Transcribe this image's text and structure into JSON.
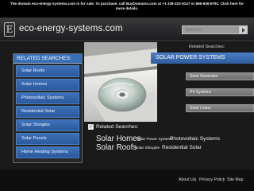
{
  "notice": "The domain eco-energy-systems.com is for sale. To purchase, call BuyDomains.com at +1 339-222-5147 or 866-836-6791. Click here for more details.",
  "header": {
    "logo_letter": "E",
    "site_title": "eco-energy-systems.com",
    "search_placeholder": "SEARCH"
  },
  "left_panel": {
    "title": "RELATED SEARCHES:",
    "items": [
      "Solar Roofs",
      "Solar Homes",
      "Photovoltaic Systems",
      "Residential Solar",
      "Solar Shingles",
      "Solar Panels",
      "Home Heating Systems"
    ]
  },
  "right_panel": {
    "related_label": "Related Searches:",
    "active": "SOLAR POWER SYSTEMS",
    "items": [
      "Solar Generator",
      "PV Systems",
      "Solar Loans"
    ]
  },
  "related_block": {
    "label": "Related Searches:",
    "row1": {
      "big": "Solar Homes",
      "small": "Solar Power Systems",
      "mid": "Photovoltaic Systems"
    },
    "row2": {
      "big": "Solar Roofs",
      "small": "Solar Shingles",
      "mid": "Residential Solar"
    }
  },
  "footer": {
    "links": [
      "About Us",
      "Privacy Policy",
      "Site Map"
    ],
    "separator": "|"
  },
  "colors": {
    "accent_blue": "#3a6fb8",
    "background": "#1a1a1b",
    "gray_item": "#7a7a7a"
  }
}
